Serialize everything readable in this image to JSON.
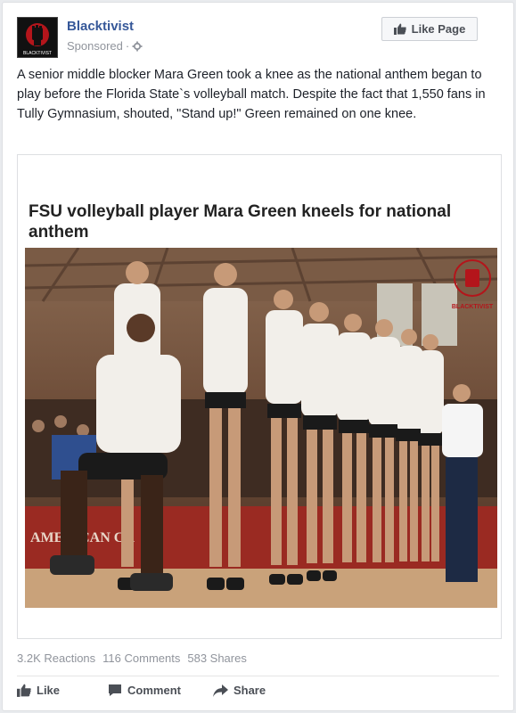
{
  "post": {
    "page_name": "Blacktivist",
    "sponsored": "Sponsored",
    "like_page_label": "Like Page",
    "text": "A senior middle blocker Mara Green took a knee as the national anthem began to play before the Florida State`s volleyball match. Despite the fact that 1,550 fans in Tully Gymnasium, shouted, \"Stand up!\" Green remained on one knee.",
    "avatar_caption": "BLACKTIVIST"
  },
  "preview": {
    "headline": "FSU volleyball player Mara Green kneels for national anthem",
    "watermark": "BLACKTIVIST",
    "banner_text": "AMERICAN CA"
  },
  "stats": {
    "reactions": "3.2K Reactions",
    "comments": "116 Comments",
    "shares": "583 Shares"
  },
  "actions": {
    "like": "Like",
    "comment": "Comment",
    "share": "Share"
  },
  "colors": {
    "link": "#365899",
    "brand_red": "#b4151b"
  }
}
